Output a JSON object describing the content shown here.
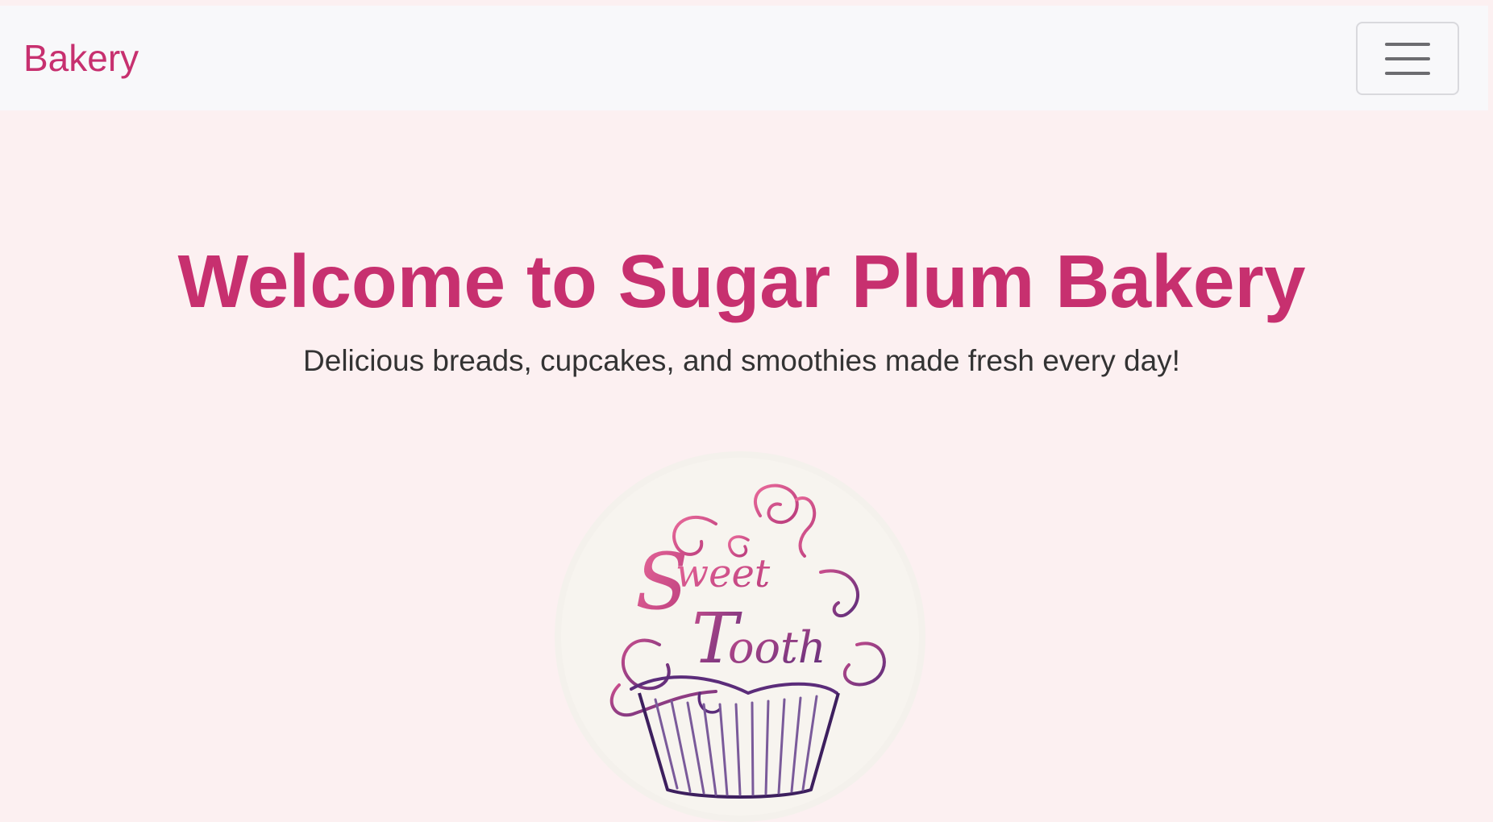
{
  "navbar": {
    "brand": "Bakery",
    "menu_icon": "hamburger-menu-icon"
  },
  "hero": {
    "title": "Welcome to Sugar Plum Bakery",
    "subtitle": "Delicious breads, cupcakes, and smoothies made fresh every day!"
  },
  "logo": {
    "text_line1": "Sweet",
    "text_line2": "Tooth",
    "icon": "cupcake-logo"
  },
  "colors": {
    "accent": "#c7306f",
    "page_background": "#fcf0f1",
    "navbar_background": "#f8f8fa",
    "text": "#333333"
  }
}
